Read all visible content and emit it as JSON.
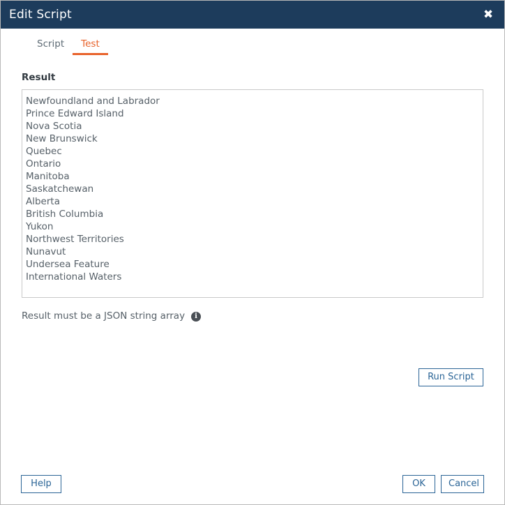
{
  "dialog": {
    "title": "Edit Script",
    "close_icon": "close-icon",
    "close_glyph": "✖"
  },
  "tabs": [
    {
      "label": "Script",
      "active": false
    },
    {
      "label": "Test",
      "active": true
    }
  ],
  "main": {
    "result_label": "Result",
    "result_lines": [
      "Newfoundland and Labrador",
      "Prince Edward Island",
      "Nova Scotia",
      "New Brunswick",
      "Quebec",
      "Ontario",
      "Manitoba",
      "Saskatchewan",
      "Alberta",
      "British Columbia",
      "Yukon",
      "Northwest Territories",
      "Nunavut",
      "Undersea Feature",
      "International Waters"
    ],
    "helper_text": "Result must be a JSON string array",
    "info_icon": "info-icon",
    "info_glyph": "i",
    "run_script_label": "Run Script"
  },
  "footer": {
    "help_label": "Help",
    "ok_label": "OK",
    "cancel_label": "Cancel"
  },
  "colors": {
    "titlebar_bg": "#1d3c5c",
    "accent_orange": "#e8622a",
    "button_blue": "#2a6496",
    "text_gray": "#555f67",
    "border_gray": "#c9c9c9"
  }
}
